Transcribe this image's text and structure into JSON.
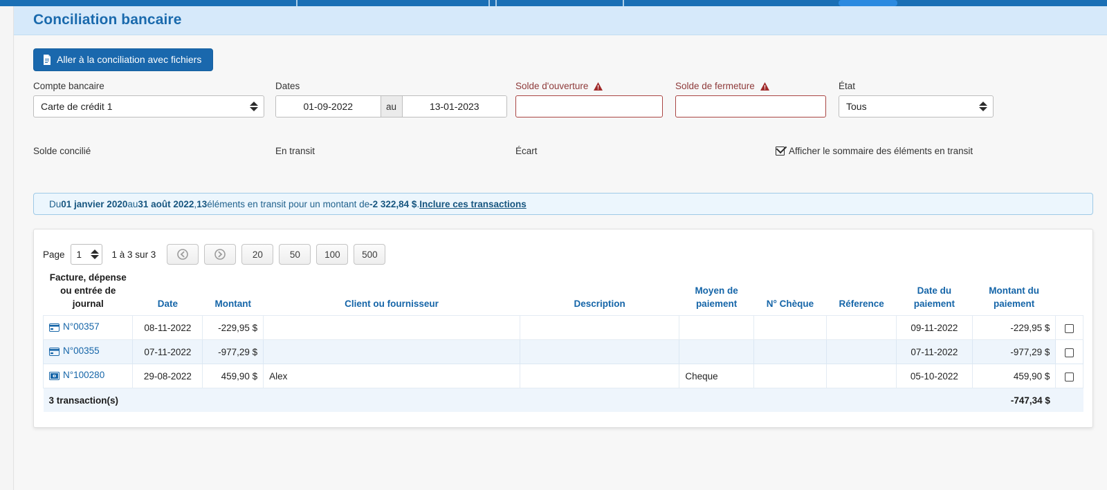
{
  "page": {
    "title": "Conciliation bancaire",
    "primary_button": "Aller à la conciliation avec fichiers",
    "primary_button_icon": "document-icon"
  },
  "filters": {
    "account": {
      "label": "Compte bancaire",
      "value": "Carte de crédit 1"
    },
    "dates": {
      "label": "Dates",
      "from": "01-09-2022",
      "separator": "au",
      "to": "13-01-2023"
    },
    "opening_balance": {
      "label": "Solde d'ouverture",
      "value": "",
      "required": true,
      "icon": "warning-triangle-icon"
    },
    "closing_balance": {
      "label": "Solde de fermeture",
      "value": "",
      "required": true,
      "icon": "warning-triangle-icon"
    },
    "state": {
      "label": "État",
      "value": "Tous"
    }
  },
  "summary": {
    "reconciled_balance_label": "Solde concilié",
    "reconciled_balance_value": "",
    "in_transit_label": "En transit",
    "in_transit_value": "",
    "difference_label": "Écart",
    "difference_value": "",
    "show_summary_checkbox": "Afficher le sommaire des éléments en transit",
    "show_summary_checked": true
  },
  "banner": {
    "prefix": "Du ",
    "date_from": "01 janvier 2020",
    "mid1": " au ",
    "date_to": "31 août 2022",
    "mid2": ", ",
    "count": "13",
    "mid3": " éléments en transit pour un montant de ",
    "amount": "-2 322,84 $",
    "mid4": ". ",
    "link": "Inclure ces transactions"
  },
  "pager": {
    "page_label": "Page",
    "page_value": "1",
    "range_text": "1 à 3 sur 3",
    "prev_icon": "circle-arrow-left-icon",
    "next_icon": "circle-arrow-right-icon",
    "sizes": [
      "20",
      "50",
      "100",
      "500"
    ]
  },
  "table": {
    "headers": [
      "Facture, dépense ou entrée de journal",
      "Date",
      "Montant",
      "Client ou fournisseur",
      "Description",
      "Moyen de paiement",
      "N° Chèque",
      "Réference",
      "Date du paiement",
      "Montant du paiement"
    ],
    "rows": [
      {
        "icon": "credit-card-icon",
        "ref": "N°00357",
        "date": "08-11-2022",
        "amount": "-229,95 $",
        "customer": "",
        "description": "",
        "payment_method": "",
        "cheque_no": "",
        "reference": "",
        "payment_date": "09-11-2022",
        "payment_amount": "-229,95 $",
        "selected": false
      },
      {
        "icon": "credit-card-icon",
        "ref": "N°00355",
        "date": "07-11-2022",
        "amount": "-977,29 $",
        "customer": "",
        "description": "",
        "payment_method": "",
        "cheque_no": "",
        "reference": "",
        "payment_date": "07-11-2022",
        "payment_amount": "-977,29 $",
        "selected": false
      },
      {
        "icon": "money-bill-icon",
        "ref": "N°100280",
        "date": "29-08-2022",
        "amount": "459,90 $",
        "customer": "Alex",
        "description": "",
        "payment_method": "Cheque",
        "cheque_no": "",
        "reference": "",
        "payment_date": "05-10-2022",
        "payment_amount": "459,90 $",
        "selected": false
      }
    ],
    "footer": {
      "count_text": "3 transaction(s)",
      "total": "-747,34 $"
    }
  },
  "colors": {
    "brand_blue": "#1a68ad",
    "title_blue": "#1a6aad",
    "header_band": "#d6e9fa",
    "error_red": "#a94442",
    "link_blue": "#1565a8",
    "alt_row": "#eef5fc"
  }
}
